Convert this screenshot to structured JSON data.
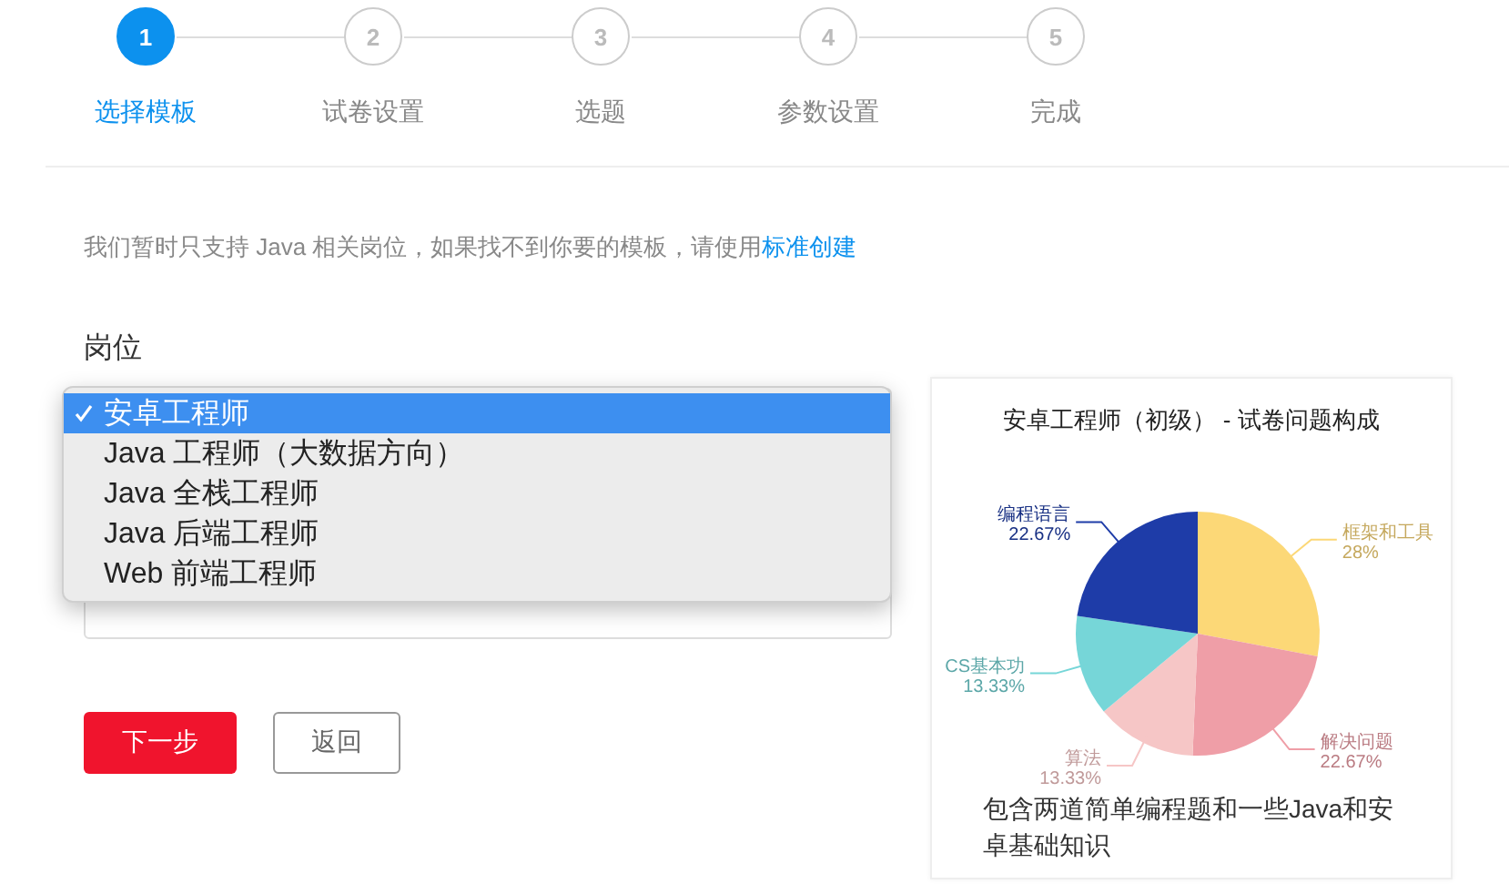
{
  "steps": [
    {
      "number": "1",
      "label": "选择模板",
      "selected": true
    },
    {
      "number": "2",
      "label": "试卷设置",
      "selected": false
    },
    {
      "number": "3",
      "label": "选题",
      "selected": false
    },
    {
      "number": "4",
      "label": "参数设置",
      "selected": false
    },
    {
      "number": "5",
      "label": "完成",
      "selected": false
    }
  ],
  "notice": {
    "text": "我们暂时只支持 Java 相关岗位，如果找不到你要的模板，请使用",
    "link": "标准创建"
  },
  "form": {
    "position_label": "岗位",
    "position_menu": [
      {
        "label": "安卓工程师",
        "selected": true
      },
      {
        "label": "Java 工程师（大数据方向）",
        "selected": false
      },
      {
        "label": "Java 全栈工程师",
        "selected": false
      },
      {
        "label": "Java 后端工程师",
        "selected": false
      },
      {
        "label": "Web 前端工程师",
        "selected": false
      }
    ],
    "buttons": [
      {
        "label": "下一步",
        "kind": "primary"
      },
      {
        "label": "返回",
        "kind": "secondary"
      }
    ]
  },
  "template_card": {
    "chart_data": {
      "type": "pie",
      "title": "安卓工程师（初级） - 试卷问题构成",
      "categories": [
        "框架和工具",
        "解决问题",
        "算法",
        "CS基本功",
        "编程语言"
      ],
      "values": [
        28,
        22.67,
        13.33,
        13.33,
        22.67
      ],
      "colors": [
        "#fcd877",
        "#ef9ea7",
        "#f6c6c6",
        "#76d6d8",
        "#1e3ca8"
      ],
      "data_labels": true,
      "value_labels": [
        "28%",
        "22.67%",
        "13.33%",
        "13.33%",
        "22.67%"
      ]
    },
    "description": "包含两道简单编程题和一些Java和安卓基础知识"
  }
}
